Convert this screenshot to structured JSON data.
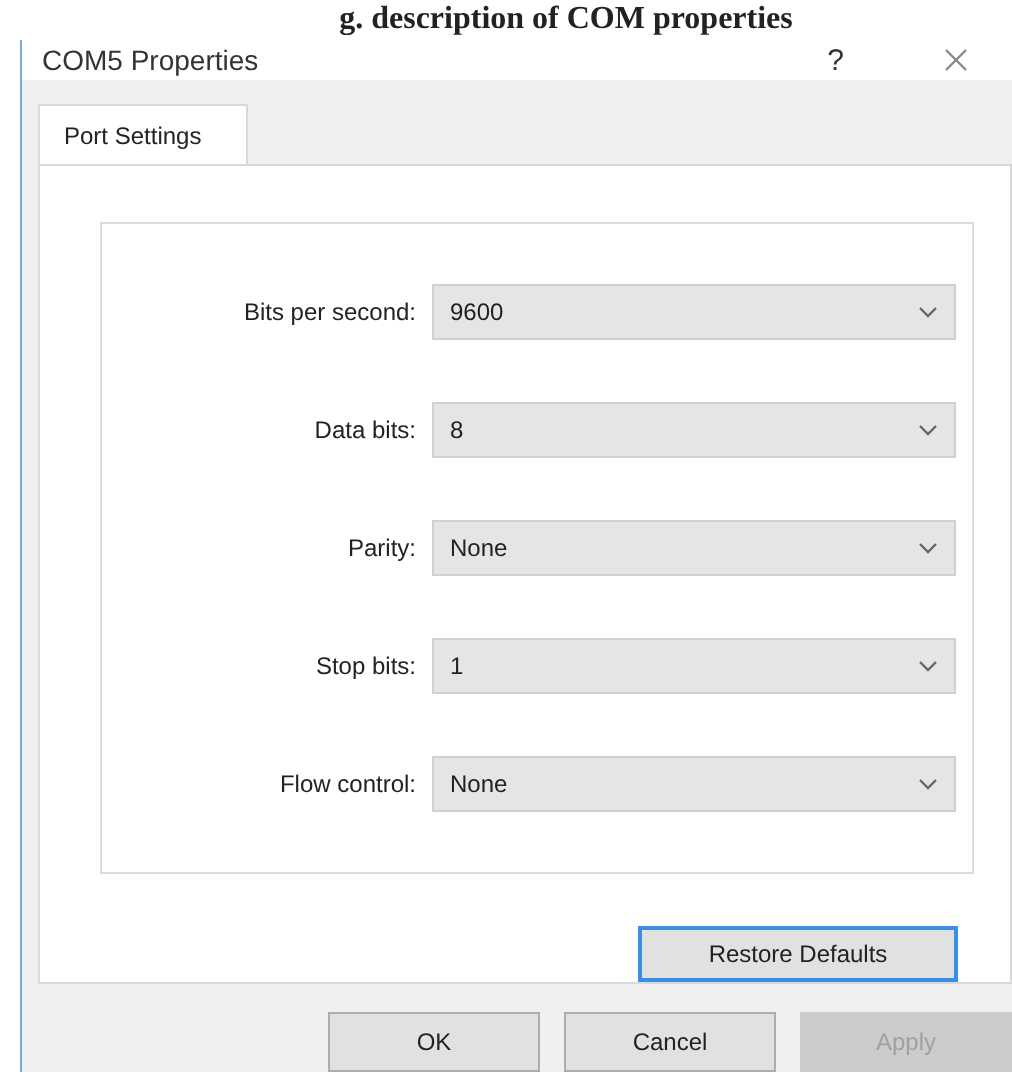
{
  "caption": "g. description of COM properties",
  "window": {
    "title": "COM5 Properties",
    "help": "?"
  },
  "tabs": [
    {
      "label": "Port Settings",
      "selected": true
    }
  ],
  "fields": [
    {
      "label": "Bits per second:",
      "value": "9600"
    },
    {
      "label": "Data bits:",
      "value": "8"
    },
    {
      "label": "Parity:",
      "value": "None"
    },
    {
      "label": "Stop bits:",
      "value": "1"
    },
    {
      "label": "Flow control:",
      "value": "None"
    }
  ],
  "restore_button": {
    "label": "Restore Defaults",
    "focused": true
  },
  "buttons": [
    {
      "label": "OK",
      "disabled": false
    },
    {
      "label": "Cancel",
      "disabled": false
    },
    {
      "label": "Apply",
      "disabled": true
    }
  ]
}
